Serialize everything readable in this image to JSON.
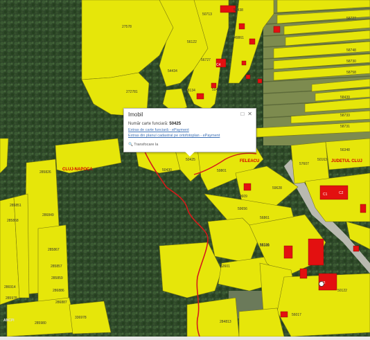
{
  "popup": {
    "title": "Imobil",
    "field_label": "Număr carte funciară:",
    "field_value": "50425",
    "link1": "Extras de carte funciară - ePayment",
    "link2": "Extras din planul cadastral pe ortofotoplan - ePayment",
    "zoom": "Transfocare la"
  },
  "map": {
    "uat_labels": [
      "CLUJ-NAPOCA",
      "FELEACU",
      "JUDETUL CLUJ"
    ],
    "parcels": [
      "50713",
      "27578",
      "50425",
      "50430",
      "48134",
      "49861",
      "50438",
      "50453",
      "54434",
      "56122",
      "56727",
      "59801",
      "59609",
      "59628",
      "59656",
      "56861",
      "56116",
      "57607",
      "50163",
      "56348",
      "285826",
      "285867",
      "285868",
      "286849",
      "285857",
      "285859",
      "285851",
      "286886",
      "286887",
      "286914",
      "285978",
      "285980",
      "336978",
      "284813",
      "56017",
      "50122",
      "52601",
      "56109",
      "272781",
      "58439",
      "58733",
      "58731",
      "58748",
      "58730",
      "58758",
      "58727"
    ],
    "building_labels": [
      "C1",
      "C2",
      "C3",
      "C4"
    ],
    "logo": "ANCPI"
  },
  "colors": {
    "forest": "#2e4a2a",
    "field": "#8a9a5e",
    "parcel_fill": "#e6e60a",
    "parcel_stroke": "#7a7a10",
    "building": "#e31010",
    "uat_border": "#d41a1a"
  }
}
